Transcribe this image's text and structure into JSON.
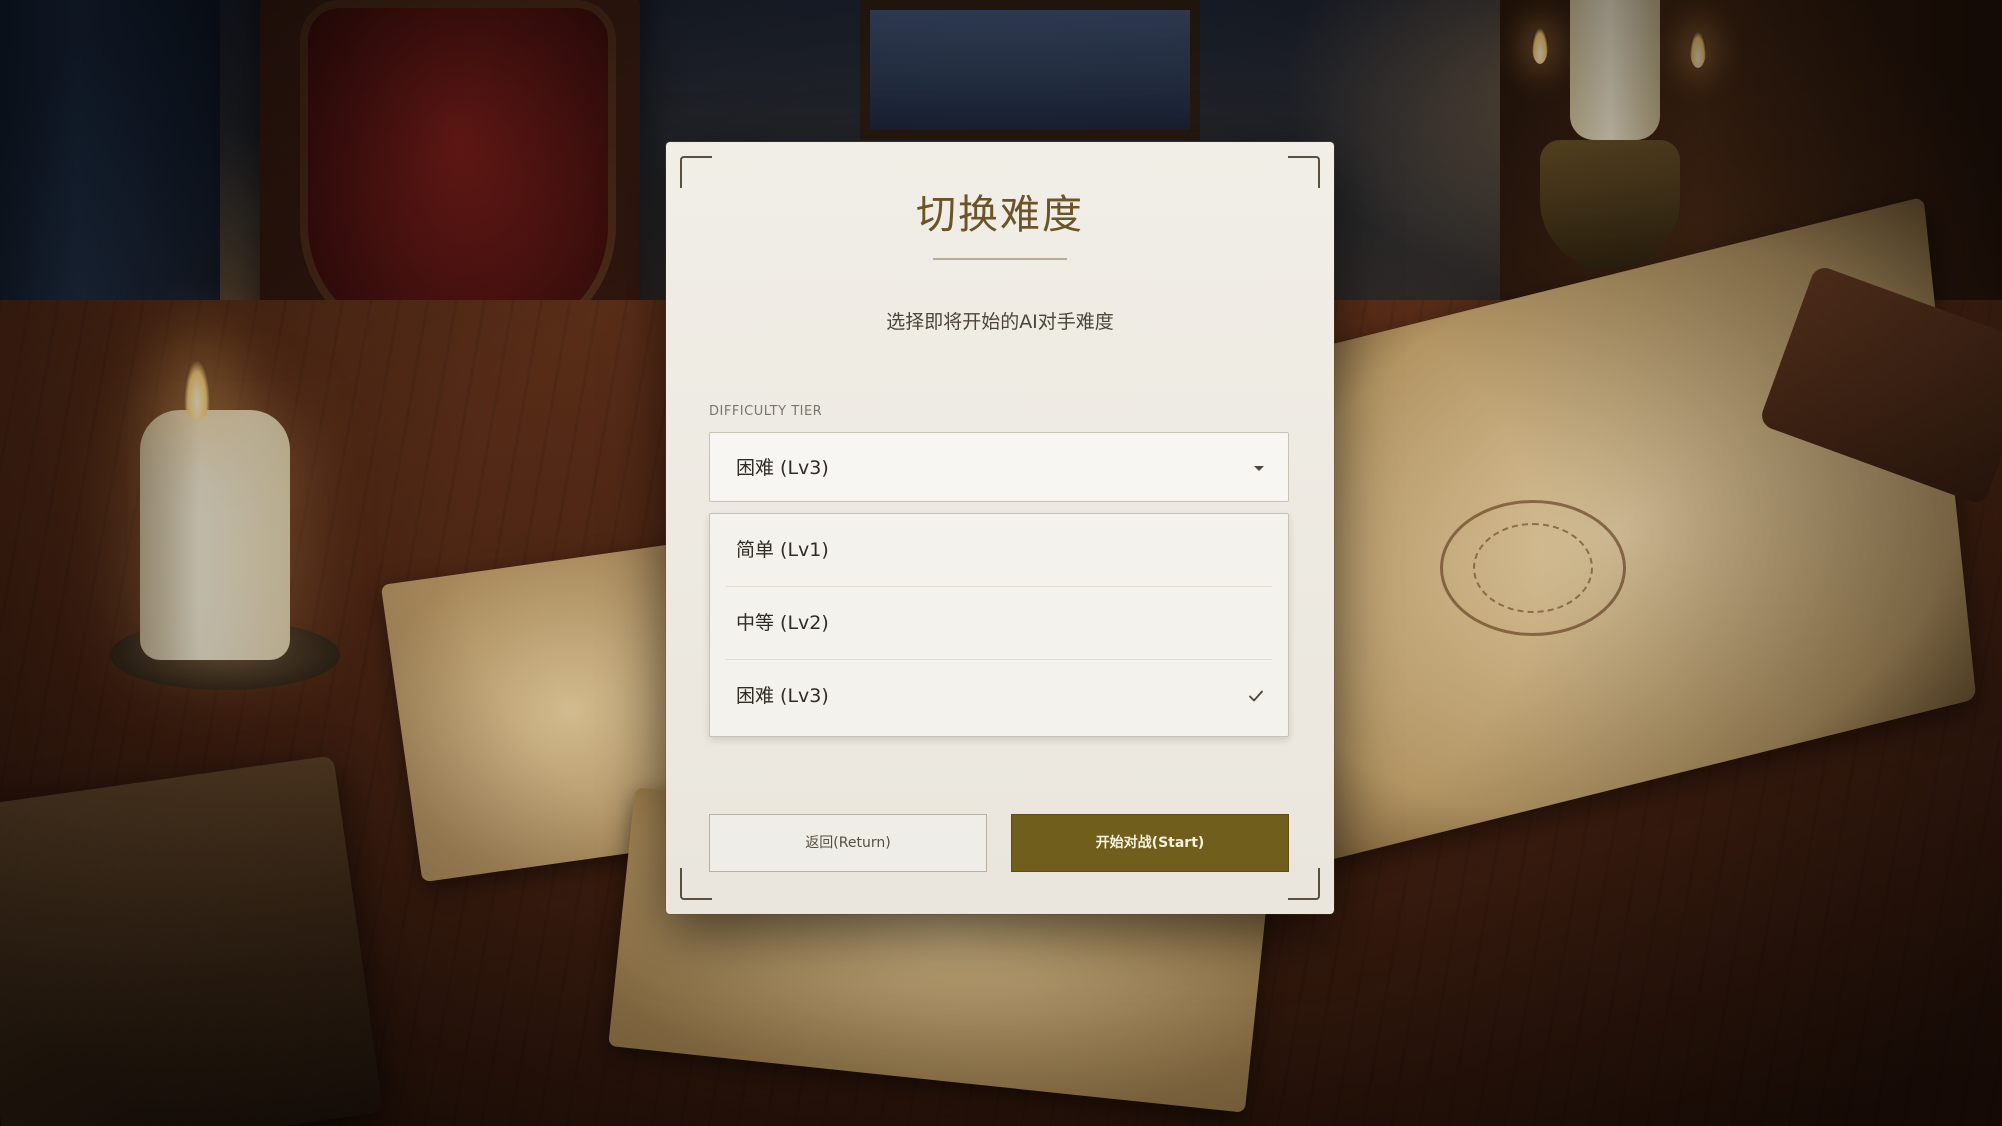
{
  "dialog": {
    "title": "切换难度",
    "subtitle": "选择即将开始的AI对手难度",
    "field_label": "DIFFICULTY TIER",
    "selected_value": "困难 (Lv3)",
    "options": [
      {
        "label": "简单 (Lv1)",
        "selected": false
      },
      {
        "label": "中等 (Lv2)",
        "selected": false
      },
      {
        "label": "困难 (Lv3)",
        "selected": true
      }
    ],
    "buttons": {
      "return_label": "返回(Return)",
      "start_label": "开始对战(Start)"
    }
  },
  "colors": {
    "accent": "#6f5e1c",
    "title": "#6b5427",
    "panel": "#f1eee7"
  },
  "icons": {
    "select_caret": "caret-down-icon",
    "selected_mark": "check-icon"
  }
}
